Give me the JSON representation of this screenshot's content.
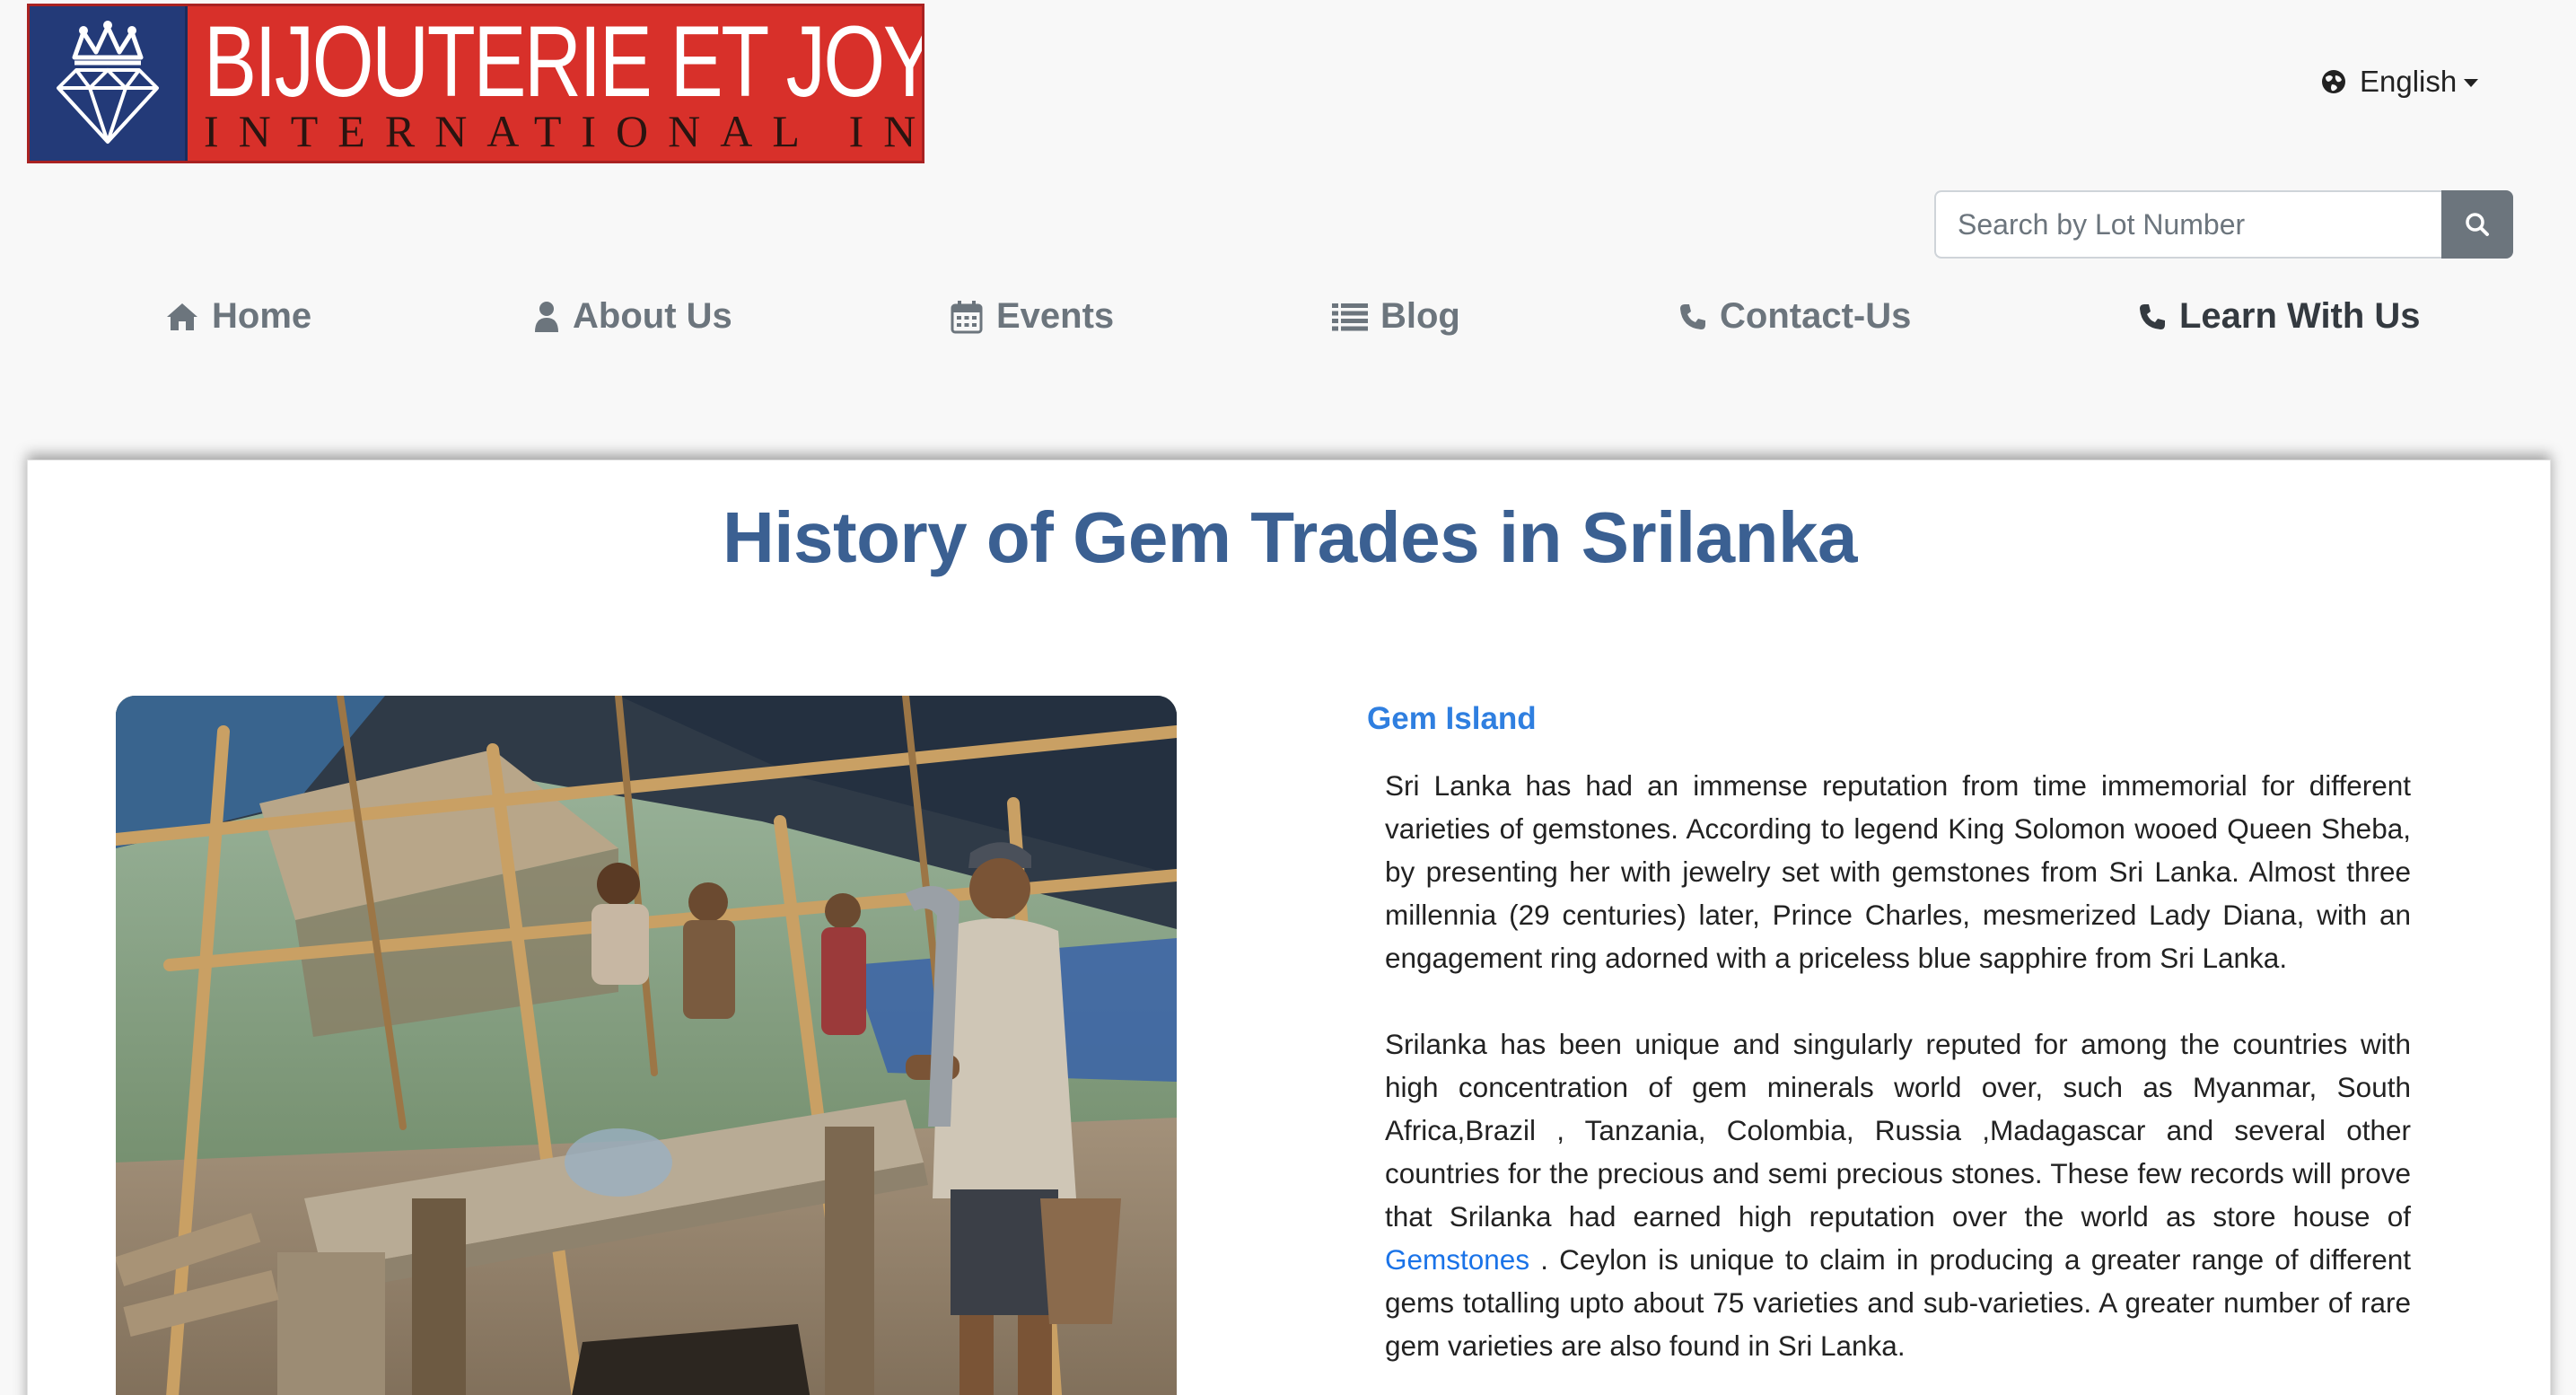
{
  "brand": {
    "line1": "BIJOUTERIE ET JOYAUX",
    "line2": "INTERNATIONAL INC."
  },
  "language": {
    "selected": "English"
  },
  "search": {
    "placeholder": "Search by Lot Number",
    "value": ""
  },
  "nav": {
    "home": "Home",
    "about": "About Us",
    "events": "Events",
    "blog": "Blog",
    "contact": "Contact-Us",
    "learn": "Learn With Us"
  },
  "page": {
    "title": "History of Gem Trades in Srilanka",
    "section_title": "Gem Island",
    "para1": "Sri Lanka has had an immense reputation from time immemorial for different varieties of gemstones. According to legend King Solomon wooed Queen Sheba, by presenting her with jewelry set with gemstones from Sri Lanka. Almost three millennia (29 centuries) later, Prince Charles, mesmerized Lady Diana, with an engagement ring adorned with a priceless blue sapphire from Sri Lanka.",
    "para2_start": "Srilanka has been unique and singularly reputed for among the countries with high concentration of gem minerals world over, such as Myanmar, South Africa,Brazil , Tanzania, Colombia, Russia ,Madagascar and several other countries for the precious and semi precious stones. These few records will prove that Srilanka had earned high reputation over the world as store house of ",
    "para2_link": "Gemstones",
    "para2_end": " . Ceylon is unique to claim in producing a greater range of different gems totalling upto about 75 varieties and sub-varieties. A greater number of rare gem varieties are also found in Sri Lanka."
  },
  "colors": {
    "title": "#3b6092",
    "section_title": "#2f7fe0",
    "link": "#1a73e8",
    "logo_red": "#d8302a",
    "logo_navy": "#233a78"
  },
  "icons": {
    "language": "globe-icon",
    "search": "search-icon",
    "home": "home-icon",
    "about": "user-icon",
    "events": "calendar-icon",
    "blog": "list-icon",
    "contact": "phone-icon",
    "learn": "phone-icon"
  }
}
